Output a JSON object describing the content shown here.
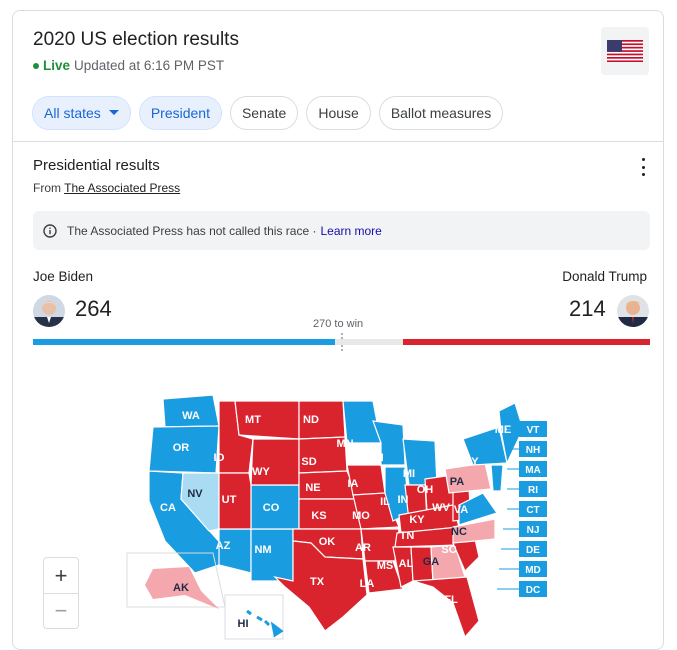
{
  "header": {
    "title": "2020 US election results",
    "live_label": "Live",
    "updated": "Updated at 6:16 PM PST",
    "flag_icon": "us-flag-icon"
  },
  "chips": [
    {
      "label": "All states",
      "selected": true,
      "dropdown": true
    },
    {
      "label": "President",
      "selected": true
    },
    {
      "label": "Senate",
      "selected": false
    },
    {
      "label": "House",
      "selected": false
    },
    {
      "label": "Ballot measures",
      "selected": false
    }
  ],
  "results": {
    "title": "Presidential results",
    "source_prefix": "From",
    "source_name": "The Associated Press",
    "notice": "The Associated Press has not called this race ·",
    "learn_more": "Learn more",
    "to_win": "270 to win"
  },
  "candidates": {
    "dem": {
      "name": "Joe Biden",
      "votes": "264",
      "color": "#1a9de0"
    },
    "rep": {
      "name": "Donald Trump",
      "votes": "214",
      "color": "#d9232d"
    }
  },
  "colors": {
    "dem": "#1a9de0",
    "dem_light": "#a9dcf3",
    "rep": "#d9232d",
    "rep_light": "#f4a8ae",
    "neutral": "#e8e8e8"
  },
  "map": {
    "state_labels": [
      "WA",
      "OR",
      "CA",
      "NV",
      "ID",
      "MT",
      "WY",
      "UT",
      "CO",
      "AZ",
      "NM",
      "ND",
      "SD",
      "NE",
      "KS",
      "OK",
      "TX",
      "MN",
      "IA",
      "MO",
      "AR",
      "LA",
      "WI",
      "IL",
      "MI",
      "IN",
      "OH",
      "KY",
      "TN",
      "MS",
      "AL",
      "GA",
      "FL",
      "SC",
      "NC",
      "VA",
      "WV",
      "PA",
      "NY",
      "ME",
      "AK",
      "HI"
    ],
    "small_states": [
      "VT",
      "NH",
      "MA",
      "RI",
      "CT",
      "NJ",
      "DE",
      "MD",
      "DC"
    ]
  },
  "zoom": {
    "plus": "+",
    "minus": "−"
  }
}
